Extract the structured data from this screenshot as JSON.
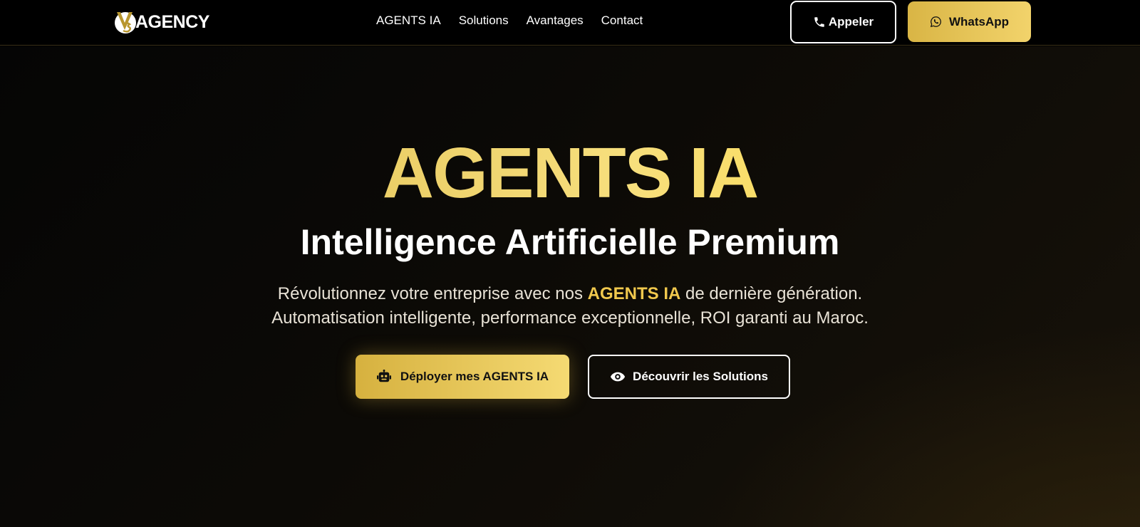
{
  "nav": {
    "logo_text": "AGENCY",
    "logo_mark": "logo-mark-icon",
    "links": [
      "AGENTS IA",
      "Solutions",
      "Avantages",
      "Contact"
    ],
    "call_label": "Appeler",
    "call_icon": "phone-icon",
    "whatsapp_label": "WhatsApp",
    "whatsapp_icon": "whatsapp-icon"
  },
  "hero": {
    "title": "AGENTS IA",
    "subtitle": "Intelligence Artificielle Premium",
    "desc_line1_prefix": "Révolutionnez votre entreprise avec nos ",
    "desc_line1_highlight": "AGENTS IA",
    "desc_line1_suffix": " de dernière génération.",
    "desc_line2": "Automatisation intelligente, performance exceptionnelle, ROI garanti au Maroc.",
    "primary_cta": "Déployer mes AGENTS IA",
    "primary_cta_icon": "robot-icon",
    "secondary_cta": "Découvrir les Solutions",
    "secondary_cta_icon": "eye-icon"
  },
  "colors": {
    "accent": "#e8c455",
    "accent_light": "#f5da73",
    "background": "#000000",
    "text": "#ffffff"
  }
}
